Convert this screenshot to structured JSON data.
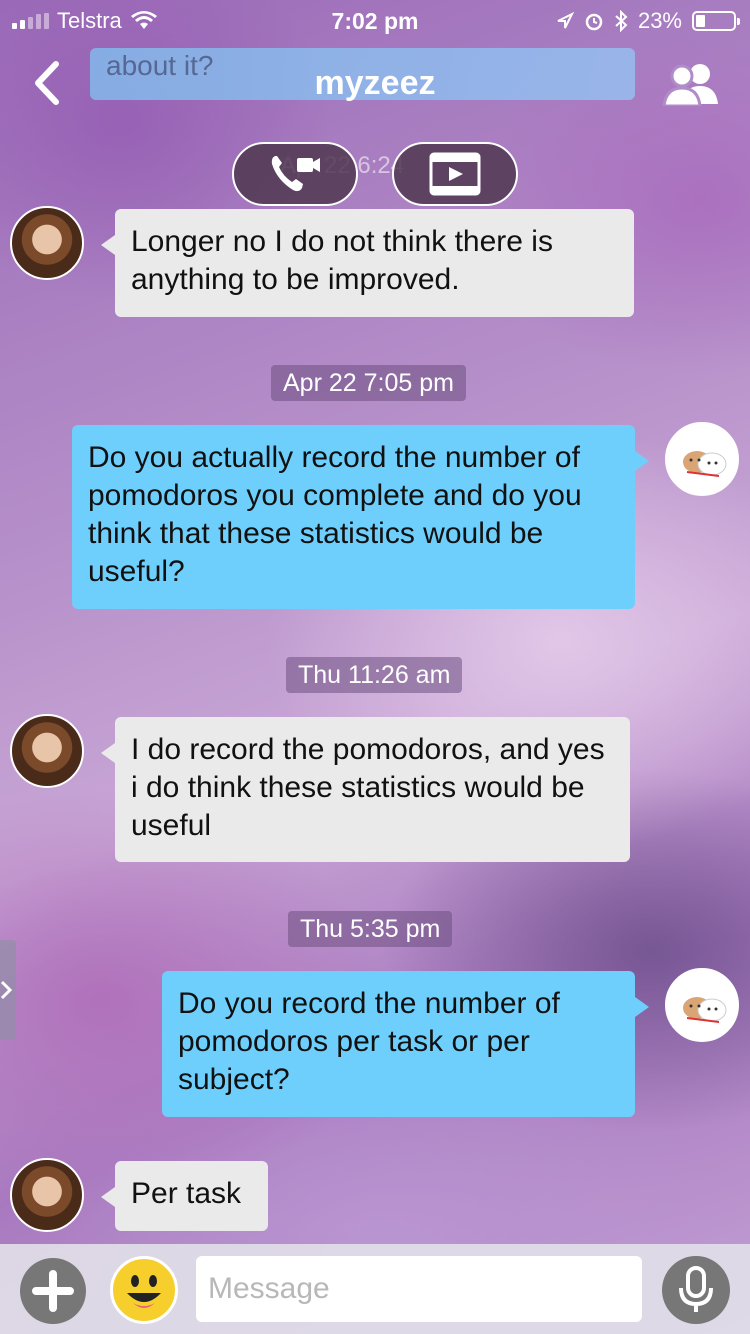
{
  "status": {
    "carrier": "Telstra",
    "time": "7:02 pm",
    "battery": "23%"
  },
  "header": {
    "preview_text": "about it?",
    "title": "myzeez"
  },
  "call_overlay": {
    "timestamp_behind": "Apr 22 6:24"
  },
  "messages": [
    {
      "type": "incoming",
      "text": "Longer no I do not think there is anything to be improved."
    },
    {
      "type": "timestamp",
      "text": "Apr 22 7:05 pm"
    },
    {
      "type": "outgoing",
      "text": "Do you actually record the number of pomodoros you complete and do you think that these statistics would be useful?"
    },
    {
      "type": "timestamp",
      "text": "Thu 11:26 am"
    },
    {
      "type": "incoming",
      "text": "I do record the pomodoros, and yes i do think these statistics would be useful"
    },
    {
      "type": "timestamp",
      "text": "Thu 5:35 pm"
    },
    {
      "type": "outgoing",
      "text": "Do you record the number of pomodoros per task or per subject?"
    },
    {
      "type": "incoming",
      "text": "Per task"
    }
  ],
  "composer": {
    "placeholder": "Message"
  },
  "colors": {
    "outgoing_bubble": "#6ecffc",
    "incoming_bubble": "#eaeaea"
  }
}
